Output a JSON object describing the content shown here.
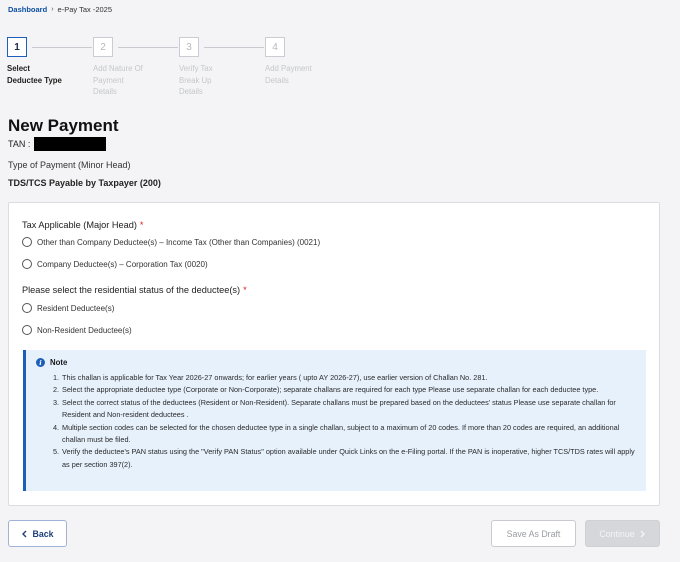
{
  "breadcrumb": {
    "home": "Dashboard",
    "separator": "›",
    "current": "e-Pay Tax -2025"
  },
  "stepper": {
    "steps": [
      {
        "number": "1",
        "label_line1": "Select",
        "label_line2": "Deductee Type",
        "label_line3": ""
      },
      {
        "number": "2",
        "label_line1": "Add Nature Of",
        "label_line2": "Payment",
        "label_line3": "Details"
      },
      {
        "number": "3",
        "label_line1": "Verify Tax",
        "label_line2": "Break Up",
        "label_line3": "Details"
      },
      {
        "number": "4",
        "label_line1": "Add Payment",
        "label_line2": "Details",
        "label_line3": ""
      }
    ]
  },
  "page": {
    "title": "New Payment",
    "tan_label": "TAN :",
    "payment_type_label": "Type of Payment (Minor Head)",
    "payment_type_value": "TDS/TCS Payable by Taxpayer (200)"
  },
  "form": {
    "tax_applicable_label": "Tax Applicable (Major Head)",
    "required_mark": "*",
    "tax_options": [
      "Other than Company Deductee(s) – Income Tax (Other than Companies) (0021)",
      "Company Deductee(s) – Corporation Tax (0020)"
    ],
    "residential_label": "Please select the residential status of the deductee(s)",
    "residential_options": [
      "Resident Deductee(s)",
      "Non-Resident Deductee(s)"
    ]
  },
  "note": {
    "title": "Note",
    "items": [
      {
        "num": "1.",
        "text": "This challan is applicable for Tax Year 2026-27 onwards; for earlier years ( upto AY 2026-27), use earlier version of Challan No. 281."
      },
      {
        "num": "2.",
        "text": "Select the appropriate deductee type (Corporate or Non-Corporate); separate challans are required for each type Please use separate challan for each deductee type."
      },
      {
        "num": "3.",
        "text": "Select the correct status of the deductees (Resident or Non-Resident). Separate challans must be prepared based on the deductees' status Please use separate challan for Resident and Non-resident deductees ."
      },
      {
        "num": "4.",
        "text": "Multiple section codes can be selected for the chosen deductee type in a single challan, subject to a maximum of 20 codes. If more than 20 codes are required, an additional challan must be filed."
      },
      {
        "num": "5.",
        "text": "Verify the deductee's PAN status using the \"Verify PAN Status\" option available under Quick Links on the e-Filing portal. If the PAN is inoperative, higher TCS/TDS rates will apply as per section 397(2)."
      }
    ]
  },
  "buttons": {
    "back": "Back",
    "save_draft": "Save As Draft",
    "continue": "Continue"
  },
  "icons": {
    "back": "chevron-left-icon",
    "continue": "chevron-right-icon",
    "note": "info-icon"
  },
  "colors": {
    "primary": "#1d5fb8",
    "note_bg": "#e7f1fc",
    "required": "#dd2222"
  }
}
